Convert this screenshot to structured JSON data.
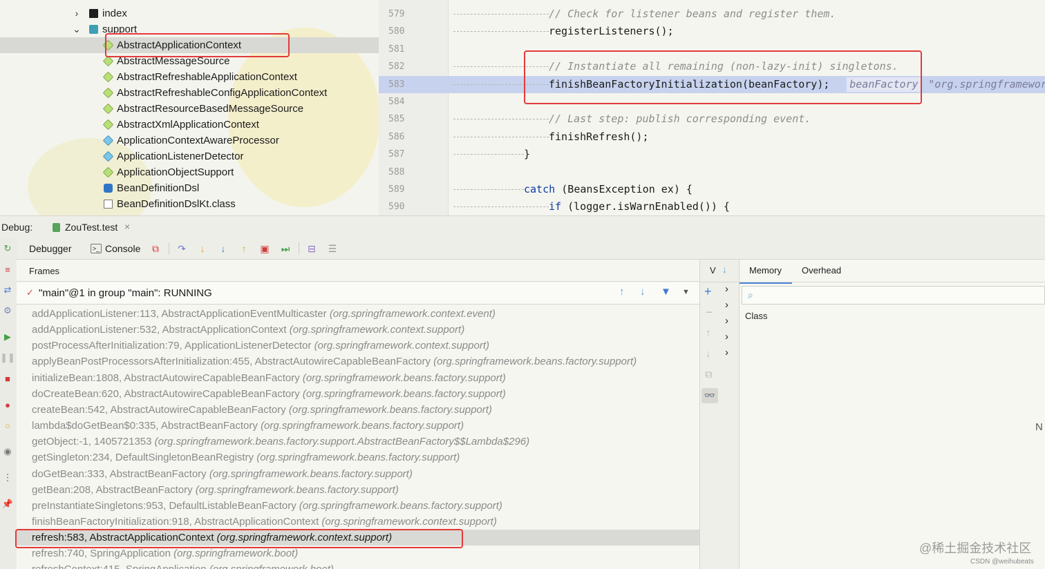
{
  "tree": {
    "items": [
      {
        "label": "index",
        "kind": "folder",
        "expanded": false,
        "depth": 0
      },
      {
        "label": "support",
        "kind": "package",
        "expanded": true,
        "depth": 0
      },
      {
        "label": "AbstractApplicationContext",
        "kind": "class",
        "selected": true
      },
      {
        "label": "AbstractMessageSource",
        "kind": "class"
      },
      {
        "label": "AbstractRefreshableApplicationContext",
        "kind": "class"
      },
      {
        "label": "AbstractRefreshableConfigApplicationContext",
        "kind": "class"
      },
      {
        "label": "AbstractResourceBasedMessageSource",
        "kind": "class"
      },
      {
        "label": "AbstractXmlApplicationContext",
        "kind": "class"
      },
      {
        "label": "ApplicationContextAwareProcessor",
        "kind": "interface"
      },
      {
        "label": "ApplicationListenerDetector",
        "kind": "interface"
      },
      {
        "label": "ApplicationObjectSupport",
        "kind": "class"
      },
      {
        "label": "BeanDefinitionDsl",
        "kind": "kotlin"
      },
      {
        "label": "BeanDefinitionDslKt.class",
        "kind": "file"
      }
    ]
  },
  "editor": {
    "lines": [
      {
        "num": "579",
        "text": "// Check for listener beans and register them.",
        "comment": true,
        "indent": 4
      },
      {
        "num": "580",
        "text": "registerListeners();",
        "indent": 4
      },
      {
        "num": "581",
        "text": "",
        "indent": 0
      },
      {
        "num": "582",
        "text": "// Instantiate all remaining (non-lazy-init) singletons.",
        "comment": true,
        "indent": 4
      },
      {
        "num": "583",
        "text": "finishBeanFactoryInitialization(beanFactory);",
        "indent": 4,
        "exec": true,
        "hint_name": "beanFactory",
        "hint_value": "\"org.springframewor"
      },
      {
        "num": "584",
        "text": "",
        "indent": 0
      },
      {
        "num": "585",
        "text": "// Last step: publish corresponding event.",
        "comment": true,
        "indent": 4
      },
      {
        "num": "586",
        "text": "finishRefresh();",
        "indent": 4
      },
      {
        "num": "587",
        "text": "}",
        "indent": 3
      },
      {
        "num": "588",
        "text": "",
        "indent": 0
      },
      {
        "num": "589",
        "keyword": "catch",
        "text": " (BeansException ex) {",
        "indent": 3
      },
      {
        "num": "590",
        "keyword": "if",
        "text": " (logger.isWarnEnabled()) {",
        "indent": 4
      }
    ]
  },
  "debug": {
    "label": "Debug:",
    "session": "ZouTest.test",
    "close": "×",
    "tabs": {
      "debugger": "Debugger",
      "console": "Console"
    },
    "frames_title": "Frames",
    "thread": "\"main\"@1 in group \"main\": RUNNING",
    "frames": [
      {
        "method": "addApplicationListener:113, AbstractApplicationEventMulticaster",
        "pkg": "(org.springframework.context.event)"
      },
      {
        "method": "addApplicationListener:532, AbstractApplicationContext",
        "pkg": "(org.springframework.context.support)"
      },
      {
        "method": "postProcessAfterInitialization:79, ApplicationListenerDetector",
        "pkg": "(org.springframework.context.support)"
      },
      {
        "method": "applyBeanPostProcessorsAfterInitialization:455, AbstractAutowireCapableBeanFactory",
        "pkg": "(org.springframework.beans.factory.support)"
      },
      {
        "method": "initializeBean:1808, AbstractAutowireCapableBeanFactory",
        "pkg": "(org.springframework.beans.factory.support)"
      },
      {
        "method": "doCreateBean:620, AbstractAutowireCapableBeanFactory",
        "pkg": "(org.springframework.beans.factory.support)"
      },
      {
        "method": "createBean:542, AbstractAutowireCapableBeanFactory",
        "pkg": "(org.springframework.beans.factory.support)"
      },
      {
        "method": "lambda$doGetBean$0:335, AbstractBeanFactory",
        "pkg": "(org.springframework.beans.factory.support)"
      },
      {
        "method": "getObject:-1, 1405721353",
        "pkg": "(org.springframework.beans.factory.support.AbstractBeanFactory$$Lambda$296)"
      },
      {
        "method": "getSingleton:234, DefaultSingletonBeanRegistry",
        "pkg": "(org.springframework.beans.factory.support)"
      },
      {
        "method": "doGetBean:333, AbstractBeanFactory",
        "pkg": "(org.springframework.beans.factory.support)"
      },
      {
        "method": "getBean:208, AbstractBeanFactory",
        "pkg": "(org.springframework.beans.factory.support)"
      },
      {
        "method": "preInstantiateSingletons:953, DefaultListableBeanFactory",
        "pkg": "(org.springframework.beans.factory.support)"
      },
      {
        "method": "finishBeanFactoryInitialization:918, AbstractApplicationContext",
        "pkg": "(org.springframework.context.support)"
      },
      {
        "method": "refresh:583, AbstractApplicationContext",
        "pkg": "(org.springframework.context.support)",
        "current": true
      },
      {
        "method": "refresh:740, SpringApplication",
        "pkg": "(org.springframework.boot)"
      },
      {
        "method": "refreshContext:415, SpringApplication",
        "pkg": "(org.springframework.boot)"
      }
    ],
    "variables_label": "V",
    "memory": {
      "tabs": {
        "memory": "Memory",
        "overhead": "Overhead"
      },
      "search_placeholder": "",
      "class_header": "Class",
      "edge_letter": "N"
    }
  },
  "watermark": {
    "main": "@稀土掘金技术社区",
    "small": "CSDN @weihubeats"
  },
  "colors": {
    "highlight_box": "#e23a3a",
    "exec_line": "#c7d3ee",
    "accent_tab": "#4a86d6"
  }
}
